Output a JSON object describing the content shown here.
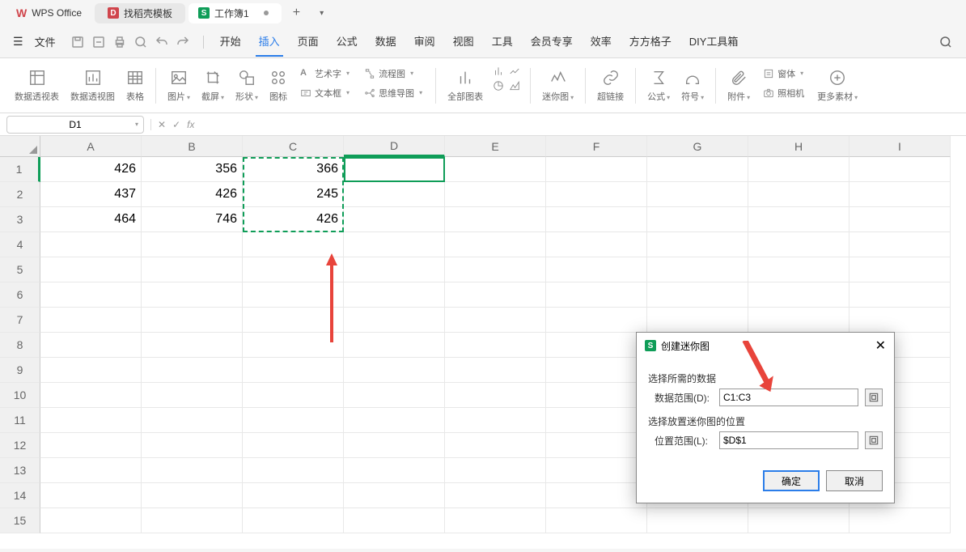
{
  "title_bar": {
    "app_name": "WPS Office",
    "tab_template": "找稻壳模板",
    "tab_workbook": "工作簿1"
  },
  "menu": {
    "file": "文件",
    "tabs": [
      "开始",
      "插入",
      "页面",
      "公式",
      "数据",
      "审阅",
      "视图",
      "工具",
      "会员专享",
      "效率",
      "方方格子",
      "DIY工具箱"
    ],
    "active_tab_index": 1
  },
  "ribbon": {
    "pivot_table": "数据透视表",
    "pivot_chart": "数据透视图",
    "table": "表格",
    "picture": "图片",
    "screenshot": "截屏",
    "shapes": "形状",
    "icons": "图标",
    "wordart": "艺术字",
    "textbox": "文本框",
    "flowchart": "流程图",
    "mindmap": "思维导图",
    "all_charts": "全部图表",
    "sparkline": "迷你图",
    "hyperlink": "超链接",
    "formula": "公式",
    "symbol": "符号",
    "attachment": "附件",
    "camera": "照相机",
    "form": "窗体",
    "more": "更多素材"
  },
  "formula_bar": {
    "name_box": "D1",
    "formula": ""
  },
  "grid": {
    "columns": [
      "A",
      "B",
      "C",
      "D",
      "E",
      "F",
      "G",
      "H",
      "I"
    ],
    "row_count": 15,
    "data": [
      [
        "426",
        "356",
        "366",
        "",
        "",
        "",
        "",
        "",
        ""
      ],
      [
        "437",
        "426",
        "245",
        "",
        "",
        "",
        "",
        "",
        ""
      ],
      [
        "464",
        "746",
        "426",
        "",
        "",
        "",
        "",
        "",
        ""
      ]
    ],
    "selected_cell": "D1",
    "copy_range": "C1:C3"
  },
  "dialog": {
    "title": "创建迷你图",
    "section1": "选择所需的数据",
    "data_range_label": "数据范围(D):",
    "data_range_value": "C1:C3",
    "section2": "选择放置迷你图的位置",
    "location_label": "位置范围(L):",
    "location_value": "$D$1",
    "ok": "确定",
    "cancel": "取消"
  }
}
